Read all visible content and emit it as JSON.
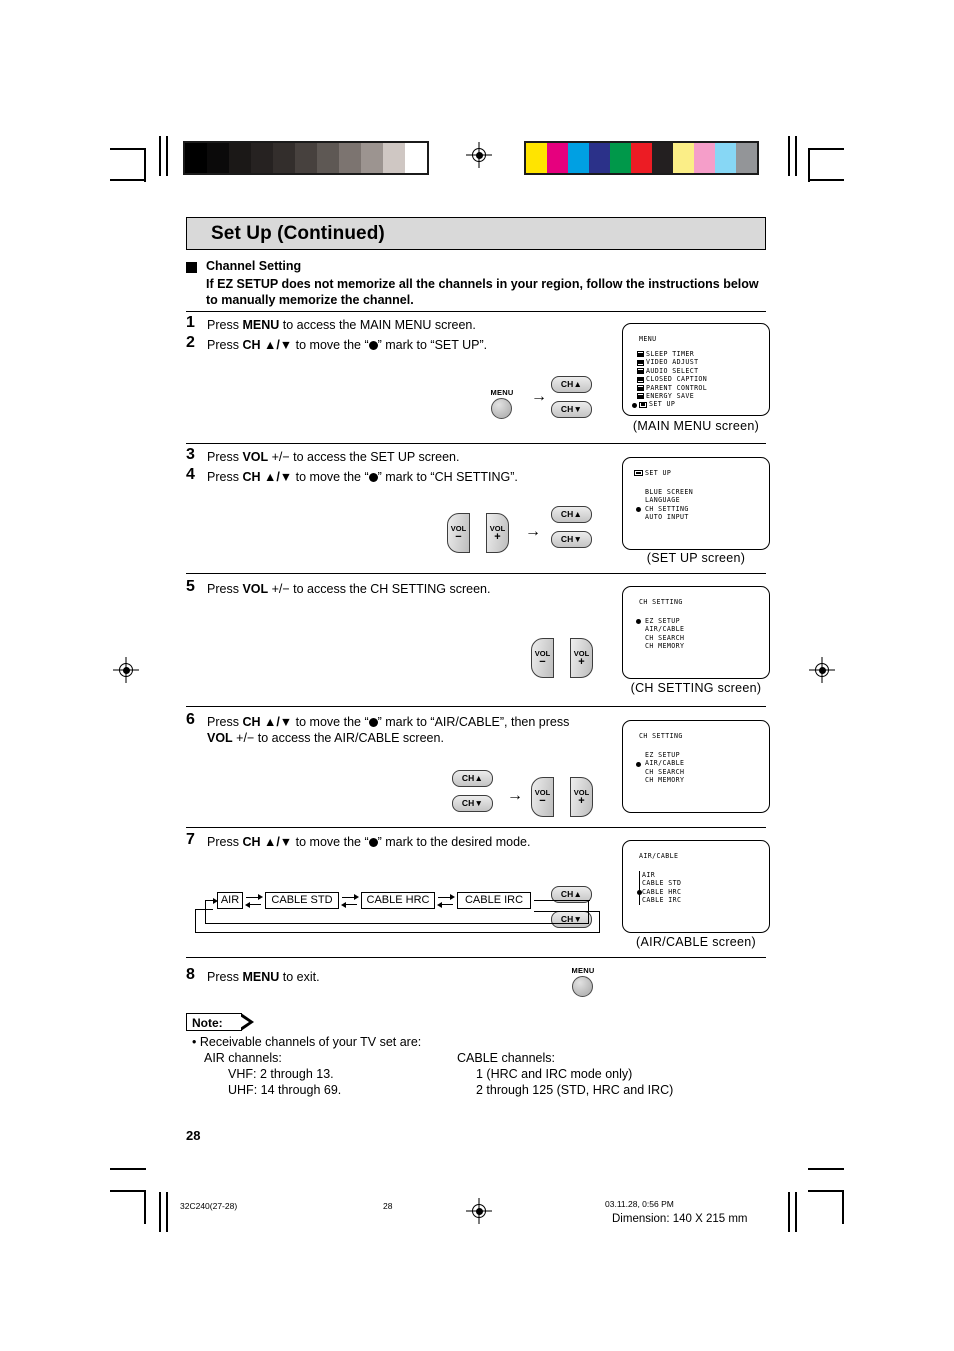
{
  "document": {
    "title": "Set Up (Continued)",
    "section_heading": "Channel Setting",
    "section_body": "If EZ SETUP does not memorize all the channels in your region, follow the instructions below to manually memorize the channel.",
    "page_number": "28"
  },
  "steps": [
    {
      "num": "1",
      "text_html": "Press <b>MENU</b> to access the MAIN MENU screen."
    },
    {
      "num": "2",
      "text_html": "Press <b>CH ▲/▼</b> to move the “<span class=\"blob\"></span>” mark to “SET UP”."
    },
    {
      "num": "3",
      "text_html": "Press <b>VOL</b> +/− to access the SET UP screen."
    },
    {
      "num": "4",
      "text_html": "Press <b>CH ▲/▼</b> to move the “<span class=\"blob\"></span>” mark to “CH SETTING”."
    },
    {
      "num": "5",
      "text_html": "Press <b>VOL</b> +/− to access the CH SETTING screen."
    },
    {
      "num": "6",
      "text_html": "Press <b>CH ▲/▼</b> to move the “<span class=\"blob\"></span>” mark to “AIR/CABLE”, then press<br><b>VOL</b> +/− to access the AIR/CABLE screen."
    },
    {
      "num": "7",
      "text_html": "Press <b>CH ▲/▼</b> to move the “<span class=\"blob\"></span>” mark to the desired mode."
    },
    {
      "num": "8",
      "text_html": "Press <b>MENU</b> to exit."
    }
  ],
  "buttons": {
    "menu_label": "MENU",
    "ch_up_label": "CH▲",
    "ch_down_label": "CH▼",
    "vol_label": "VOL",
    "vol_minus_sign": "−",
    "vol_plus_sign": "+",
    "arrow_glyph": "→"
  },
  "osd_screens": [
    {
      "id": "main-menu",
      "header": "MENU",
      "caption": "(MAIN MENU screen)",
      "items": [
        {
          "label": "SLEEP TIMER",
          "marker": "icon",
          "icon": "sleep-timer-icon"
        },
        {
          "label": "VIDEO ADJUST",
          "marker": "icon",
          "icon": "video-adjust-icon"
        },
        {
          "label": "AUDIO SELECT",
          "marker": "icon",
          "icon": "audio-select-icon"
        },
        {
          "label": "CLOSED CAPTION",
          "marker": "icon",
          "icon": "closed-caption-icon"
        },
        {
          "label": "PARENT CONTROL",
          "marker": "icon",
          "icon": "parent-control-icon"
        },
        {
          "label": "ENERGY SAVE",
          "marker": "icon",
          "icon": "energy-save-icon"
        },
        {
          "label": "SET UP",
          "marker": "dot-and-icon",
          "icon": "set-up-icon"
        }
      ]
    },
    {
      "id": "set-up",
      "header": "SET UP",
      "header_icon": "set-up-icon",
      "caption": "(SET UP screen)",
      "items": [
        {
          "label": "BLUE SCREEN",
          "marker": "none"
        },
        {
          "label": "LANGUAGE",
          "marker": "none"
        },
        {
          "label": "CH SETTING",
          "marker": "dot"
        },
        {
          "label": "AUTO INPUT",
          "marker": "none"
        }
      ]
    },
    {
      "id": "ch-setting-ez",
      "header": "CH SETTING",
      "caption": "(CH SETTING screen)",
      "items": [
        {
          "label": "EZ SETUP",
          "marker": "dot"
        },
        {
          "label": "AIR/CABLE",
          "marker": "none"
        },
        {
          "label": "CH SEARCH",
          "marker": "none"
        },
        {
          "label": "CH MEMORY",
          "marker": "none"
        }
      ]
    },
    {
      "id": "ch-setting-aircable",
      "header": "CH SETTING",
      "caption": "",
      "items": [
        {
          "label": "EZ SETUP",
          "marker": "none"
        },
        {
          "label": "AIR/CABLE",
          "marker": "dot"
        },
        {
          "label": "CH SEARCH",
          "marker": "none"
        },
        {
          "label": "CH MEMORY",
          "marker": "none"
        }
      ]
    },
    {
      "id": "air-cable",
      "header": "AIR/CABLE",
      "caption": "(AIR/CABLE screen)",
      "items": [
        {
          "label": "AIR",
          "marker": "bar"
        },
        {
          "label": "CABLE STD",
          "marker": "bar"
        },
        {
          "label": "CABLE HRC",
          "marker": "dot-bar"
        },
        {
          "label": "CABLE IRC",
          "marker": "bar"
        }
      ]
    }
  ],
  "cycle_diagram": {
    "name": "air-cable-mode-cycle",
    "nodes": [
      "AIR",
      "CABLE STD",
      "CABLE HRC",
      "CABLE IRC"
    ]
  },
  "note": {
    "label": "Note:",
    "lines": [
      "• Receivable channels of your TV set are:",
      "AIR channels:",
      "VHF: 2 through 13.",
      "UHF: 14 through 69.",
      "CABLE channels:",
      "1 (HRC and IRC mode only)",
      "2 through 125 (STD, HRC and IRC)"
    ]
  },
  "footer": {
    "job_code": "32C240(27-28)",
    "page": "28",
    "timestamp": "03.11.28, 0:56 PM",
    "dimension": "Dimension: 140  X 215 mm"
  },
  "print_marks": {
    "grayscale": [
      "#000000",
      "#0b0a0a",
      "#1b1817",
      "#262221",
      "#332e2c",
      "#47413e",
      "#5e5854",
      "#7c7470",
      "#9c9490",
      "#cfc7c3",
      "#ffffff"
    ],
    "colors": [
      "#ffe400",
      "#e6007e",
      "#00a0e3",
      "#2b3189",
      "#00984a",
      "#ec1c24",
      "#231f20",
      "#fbee87",
      "#f59ec9",
      "#87d7f5",
      "#939598"
    ]
  }
}
